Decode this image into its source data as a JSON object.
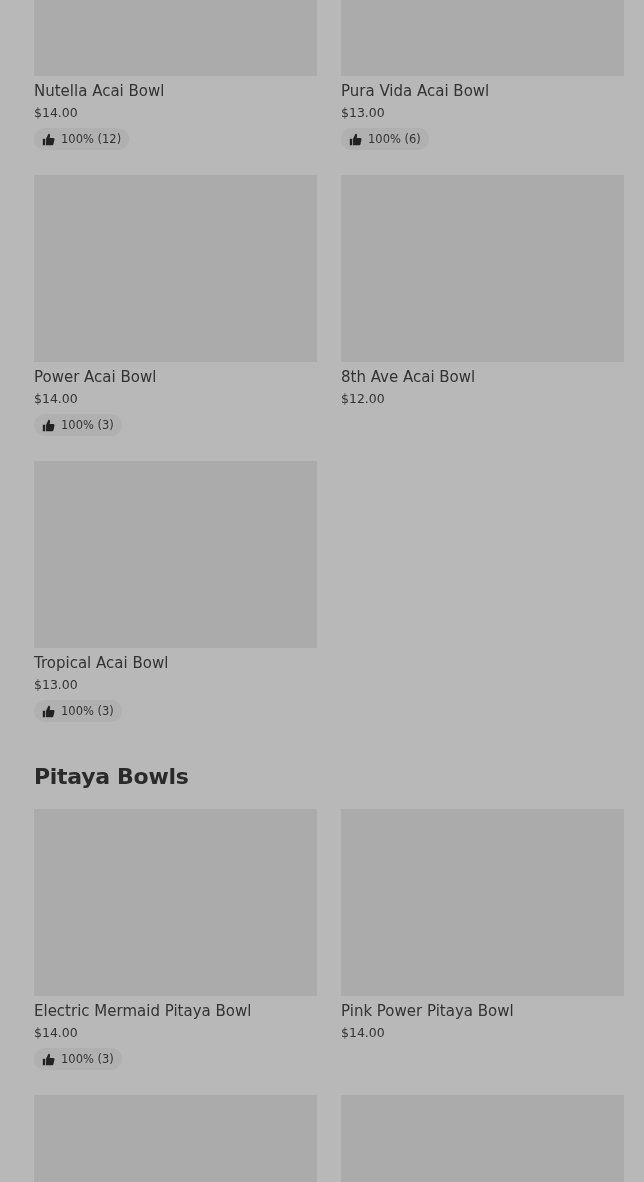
{
  "sections": [
    {
      "items": [
        {
          "kind": "dish",
          "name": "Nutella Acai Bowl",
          "price": "$14.00",
          "rating": "100% (12)"
        },
        {
          "kind": "dish",
          "name": "Pura Vida Acai Bowl",
          "price": "$13.00",
          "rating": "100% (6)"
        },
        {
          "kind": "dish",
          "name": "Power Acai Bowl",
          "price": "$14.00",
          "rating": "100% (3)"
        },
        {
          "kind": "dish",
          "name": "8th Ave Acai Bowl",
          "price": "$12.00"
        },
        {
          "kind": "dish",
          "name": "Tropical Acai Bowl",
          "price": "$13.00",
          "rating": "100% (3)"
        }
      ]
    },
    {
      "title": "Pitaya Bowls",
      "items": [
        {
          "kind": "dish",
          "name": "Electric Mermaid Pitaya Bowl",
          "price": "$14.00",
          "rating": "100% (3)"
        },
        {
          "kind": "dish",
          "name": "Pink Power Pitaya Bowl",
          "price": "$14.00"
        },
        {
          "kind": "image-only"
        },
        {
          "kind": "image-only"
        }
      ]
    }
  ]
}
